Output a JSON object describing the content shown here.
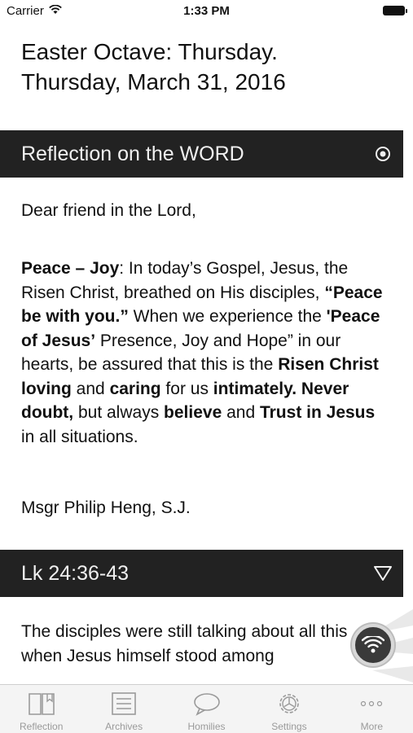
{
  "status_bar": {
    "carrier": "Carrier",
    "time": "1:33 PM"
  },
  "title": {
    "line1": "Easter Octave: Thursday.",
    "line2": "Thursday, March 31, 2016"
  },
  "reflection_section": {
    "header": "Reflection on the WORD",
    "icon": "target-icon",
    "greeting": "Dear friend in the Lord,",
    "paragraph": [
      {
        "text": "Peace – Joy",
        "bold": true
      },
      {
        "text": ": In today’s Gospel, Jesus, the Risen Christ, breathed on His disciples, ",
        "bold": false
      },
      {
        "text": "“Peace be with you.”",
        "bold": true
      },
      {
        "text": "  When we experience the ",
        "bold": false
      },
      {
        "text": "'Peace of Jesus’",
        "bold": true
      },
      {
        "text": " Presence, Joy and Hope” in our hearts, be assured that this is the ",
        "bold": false
      },
      {
        "text": "Risen Christ loving",
        "bold": true
      },
      {
        "text": " and ",
        "bold": false
      },
      {
        "text": "caring",
        "bold": true
      },
      {
        "text": " for us ",
        "bold": false
      },
      {
        "text": "intimately. Never doubt,",
        "bold": true
      },
      {
        "text": " but always ",
        "bold": false
      },
      {
        "text": "believe",
        "bold": true
      },
      {
        "text": " and ",
        "bold": false
      },
      {
        "text": "Trust in Jesus",
        "bold": true
      },
      {
        "text": " in all situations.",
        "bold": false
      }
    ],
    "author": "Msgr Philip Heng, S.J."
  },
  "reading_section": {
    "header": "Lk 24:36-43",
    "icon": "triangle-down-icon",
    "text": "The disciples were still talking about all this when Jesus himself stood among"
  },
  "tab_bar": {
    "tabs": [
      {
        "label": "Reflection",
        "icon": "book-icon"
      },
      {
        "label": "Archives",
        "icon": "list-icon"
      },
      {
        "label": "Homilies",
        "icon": "speech-bubble-icon"
      },
      {
        "label": "Settings",
        "icon": "gear-icon"
      },
      {
        "label": "More",
        "icon": "more-dots-icon"
      }
    ]
  },
  "colors": {
    "header_bg": "#222222",
    "tab_inactive": "#9a9a9a",
    "text": "#111111"
  }
}
